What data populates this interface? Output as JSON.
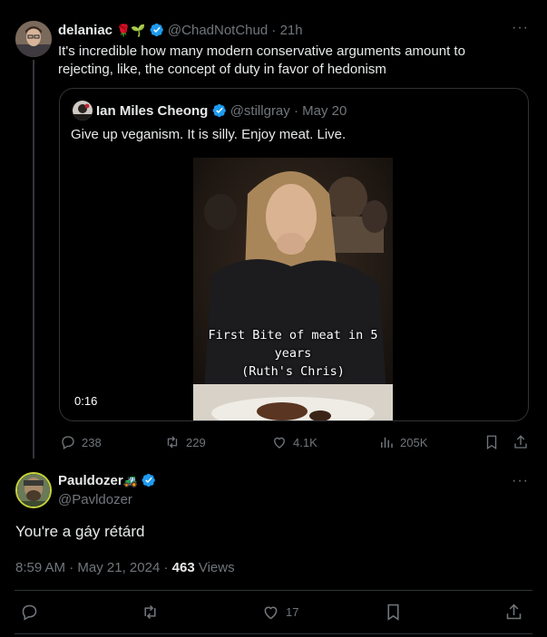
{
  "first_post": {
    "display_name": "delaniac",
    "name_emojis": "🌹🌱",
    "handle": "@ChadNotChud",
    "separator": "·",
    "time": "21h",
    "text_line1": "It's incredible how many modern conservative arguments amount to",
    "text_line2": "rejecting, like, the concept of duty in favor of hedonism",
    "quote": {
      "display_name": "Ian Miles Cheong",
      "handle": "@stillgray",
      "separator": "·",
      "date": "May 20",
      "text": "Give up veganism. It is silly. Enjoy meat. Live.",
      "video_caption_line1": "First Bite of meat in 5",
      "video_caption_line2": "years",
      "video_caption_line3": "(Ruth's Chris)",
      "video_duration": "0:16"
    },
    "actions": {
      "replies": "238",
      "reposts": "229",
      "likes": "4.1K",
      "views": "205K"
    }
  },
  "reply_post": {
    "display_name": "Pauldozer",
    "name_emoji": "🚜",
    "handle": "@Pavldozer",
    "text": "You're a gáy rétárd",
    "time": "8:59 AM",
    "separator": "·",
    "date": "May 21, 2024",
    "view_count": "463",
    "views_label": "Views",
    "likes": "17"
  },
  "colors": {
    "background": "#000000",
    "text": "#e7e9ea",
    "muted": "#71767b",
    "border": "#2f3336",
    "verified_blue": "#1d9bf0"
  }
}
